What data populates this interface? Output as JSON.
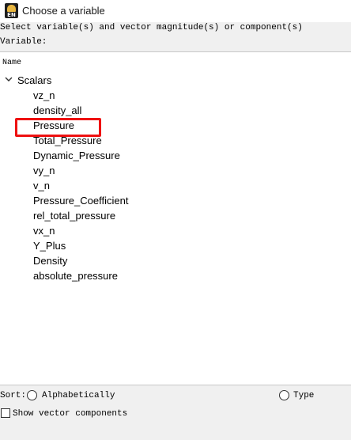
{
  "window": {
    "title": "Choose a variable",
    "icon": "app-logo-icon",
    "icon_text": "EN"
  },
  "prompt_text": "Select variable(s) and vector magnitude(s) or component(s)",
  "variable_label": "Variable:",
  "tree": {
    "column_header": "Name",
    "group": {
      "label": "Scalars",
      "expanded": true,
      "icon": "chevron-down-icon"
    },
    "items": [
      {
        "label": "vz_n"
      },
      {
        "label": "density_all"
      },
      {
        "label": "Pressure",
        "highlighted": true
      },
      {
        "label": "Total_Pressure"
      },
      {
        "label": "Dynamic_Pressure"
      },
      {
        "label": "vy_n"
      },
      {
        "label": "v_n"
      },
      {
        "label": "Pressure_Coefficient"
      },
      {
        "label": "rel_total_pressure"
      },
      {
        "label": "vx_n"
      },
      {
        "label": "Y_Plus"
      },
      {
        "label": "Density"
      },
      {
        "label": "absolute_pressure"
      }
    ]
  },
  "sort": {
    "label": "Sort:",
    "options": [
      {
        "label": "Alphabetically",
        "selected": false
      },
      {
        "label": "Type",
        "selected": false
      }
    ]
  },
  "show_vector_components": {
    "label": "Show vector components",
    "checked": false
  },
  "colors": {
    "highlight": "#ee1111",
    "panel_background": "#ffffff",
    "window_background": "#f0f0f0"
  }
}
